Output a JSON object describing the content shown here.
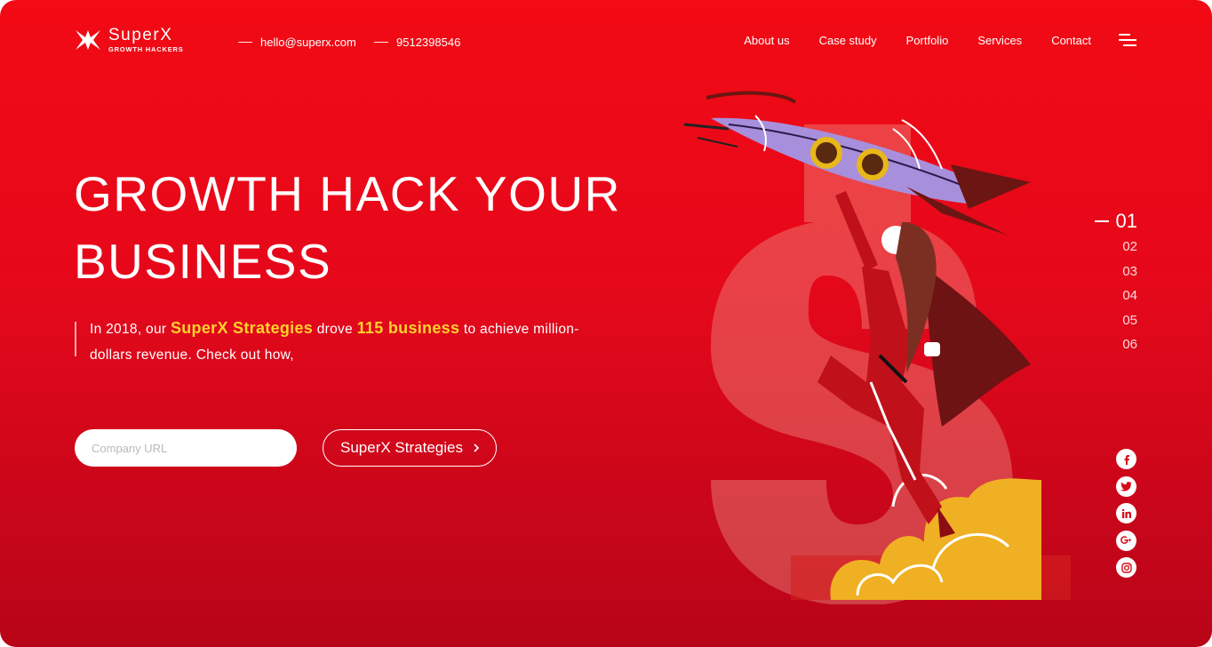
{
  "brand": {
    "name": "SuperX",
    "tagline": "GROWTH HACKERS"
  },
  "header": {
    "email": "hello@superx.com",
    "phone": "9512398546",
    "nav": [
      {
        "label": "About us"
      },
      {
        "label": "Case study"
      },
      {
        "label": "Portfolio"
      },
      {
        "label": "Services"
      },
      {
        "label": "Contact"
      }
    ],
    "menu_icon": "hamburger-icon"
  },
  "hero": {
    "headline_line1": "GROWTH HACK YOUR",
    "headline_line2": "BUSINESS",
    "lead_part1": "In 2018, our ",
    "lead_highlight1": "SuperX Strategies",
    "lead_part2": " drove ",
    "lead_highlight2": "115 business",
    "lead_part3": " to achieve million-dollars revenue. Check out how,",
    "url_placeholder": "Company URL",
    "cta_label": "SuperX Strategies",
    "cta_icon": "chevron-right-icon"
  },
  "pager": {
    "items": [
      "01",
      "02",
      "03",
      "04",
      "05",
      "06"
    ],
    "active_index": 0
  },
  "social": [
    "facebook-icon",
    "twitter-icon",
    "linkedin-icon",
    "google-plus-icon",
    "instagram-icon"
  ],
  "colors": {
    "background": "#e5081b",
    "highlight": "#ffd22c",
    "text": "#ffffff"
  }
}
